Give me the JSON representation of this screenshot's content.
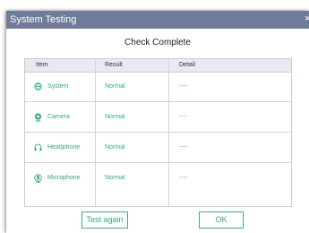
{
  "window": {
    "title": "System Testing",
    "close_glyph": "×"
  },
  "heading": "Check Complete",
  "table": {
    "columns": [
      "Item",
      "Result",
      "Detail"
    ],
    "rows": [
      {
        "item": "System",
        "icon": "globe-icon",
        "result": "Normal",
        "detail": "----"
      },
      {
        "item": "Camera",
        "icon": "camera-icon",
        "result": "Normal",
        "detail": "----"
      },
      {
        "item": "Headphone",
        "icon": "headphone-icon",
        "result": "Normal",
        "detail": "----"
      },
      {
        "item": "Microphone",
        "icon": "microphone-icon",
        "result": "Normal",
        "detail": "----"
      }
    ]
  },
  "buttons": {
    "test_again": "Test again",
    "ok": "OK"
  },
  "colors": {
    "titlebar": "#6f7c99",
    "accent_green": "#2cae78",
    "detail_blue": "#4aa3f0",
    "header_bg": "#e8e9f1"
  }
}
